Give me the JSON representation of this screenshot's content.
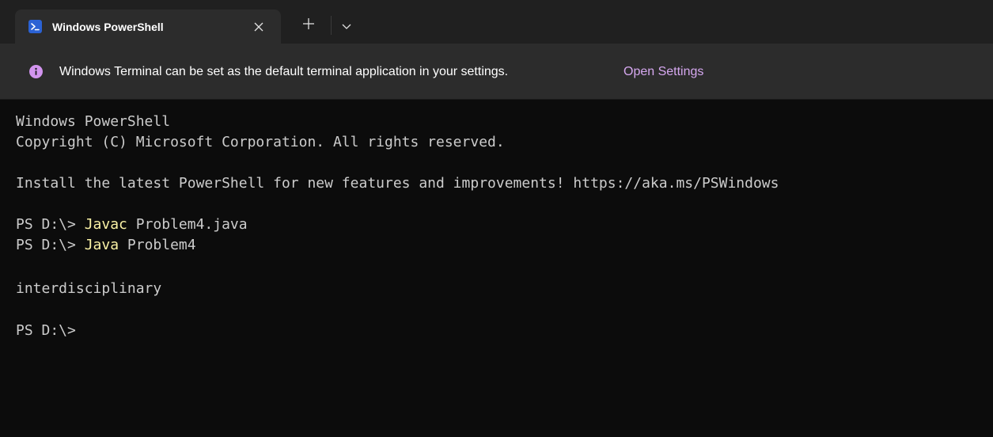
{
  "tabs": [
    {
      "title": "Windows PowerShell",
      "icon": "powershell-icon",
      "close_icon": "close-icon"
    }
  ],
  "tabbar": {
    "new_tab_icon": "plus-icon",
    "dropdown_icon": "chevron-down-icon"
  },
  "infobar": {
    "icon": "info-icon",
    "message": "Windows Terminal can be set as the default terminal application in your settings.",
    "link_label": "Open Settings"
  },
  "terminal": {
    "header_line1": "Windows PowerShell",
    "header_line2": "Copyright (C) Microsoft Corporation. All rights reserved.",
    "install_line": "Install the latest PowerShell for new features and improvements! https://aka.ms/PSWindows",
    "commands": [
      {
        "prompt": "PS D:\\> ",
        "command": "Javac",
        "args": " Problem4.java"
      },
      {
        "prompt": "PS D:\\> ",
        "command": "Java",
        "args": " Problem4"
      }
    ],
    "output": "interdisciplinary",
    "final_prompt": "PS D:\\>"
  },
  "colors": {
    "background": "#0c0c0c",
    "titlebar": "#202020",
    "tab_active": "#2c2c2c",
    "foreground": "#cccccc",
    "command": "#f9f1a5",
    "accent_link": "#d6a8f0",
    "powershell_blue": "#2b62d4"
  }
}
